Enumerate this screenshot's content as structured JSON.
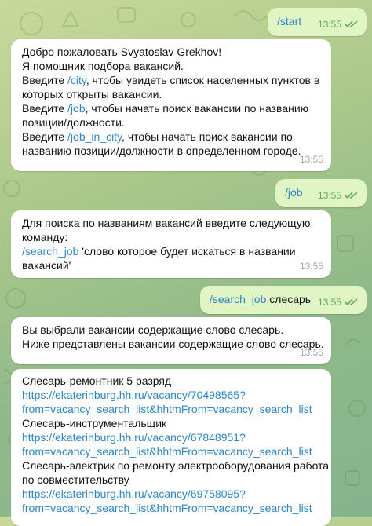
{
  "colors": {
    "incoming": "#ffffff",
    "outgoing": "#e1f5c4",
    "link": "#2c86c8",
    "time_in": "#a3a9ae",
    "time_out": "#5fa85a"
  },
  "messages": {
    "m1": {
      "text": "/start",
      "time": "13:55"
    },
    "m2": {
      "l1": "Добро пожаловать Svyatoslav Grekhov!",
      "l2": "Я помощник подбора вакансий.",
      "l3a": "Введите ",
      "l3cmd": "/city",
      "l3b": ", чтобы увидеть список населенных пунктов в",
      "l4": "которых открыты вакансии.",
      "l5a": "Введите ",
      "l5cmd": "/job",
      "l5b": ", чтобы начать поиск вакансии по названию",
      "l6": "позиции/должности.",
      "l7a": "Введите ",
      "l7cmd": "/job_in_city",
      "l7b": ", чтобы начать поиск вакансии по",
      "l8": "названию позиции/должности в определенном городе.",
      "time": "13:55"
    },
    "m3": {
      "text": "/job",
      "time": "13:55"
    },
    "m4": {
      "l1": "Для поиска по названиям вакансий введите следующую",
      "l2": "команду:",
      "l3cmd": "/search_job",
      "l3b": " 'слово которое будет искаться в названии",
      "l4": "вакансий'",
      "time": "13:55"
    },
    "m5": {
      "cmd": "/search_job",
      "text": " слесарь",
      "time": "13:55"
    },
    "m6": {
      "l1": "Вы выбрали вакансии содержащие слово слесарь.",
      "l2": "Ниже представлены вакансии содержащие слово слесарь.",
      "time": "13:55"
    },
    "m7": {
      "l1": "Слесарь-ремонтник 5 разряд",
      "l2": "https://ekaterinburg.hh.ru/vacancy/70498565?",
      "l3": "from=vacancy_search_list&hhtmFrom=vacancy_search_list",
      "l4": "Слесарь-инструментальщик",
      "l5": "https://ekaterinburg.hh.ru/vacancy/67848951?",
      "l6": "from=vacancy_search_list&hhtmFrom=vacancy_search_list",
      "l7": "Слесарь-электрик по ремонту электрооборудования работа",
      "l8": "по совместительству",
      "l9": "https://ekaterinburg.hh.ru/vacancy/69758095?",
      "l10": "from=vacancy_search_list&hhtmFrom=vacancy_search_list"
    }
  }
}
